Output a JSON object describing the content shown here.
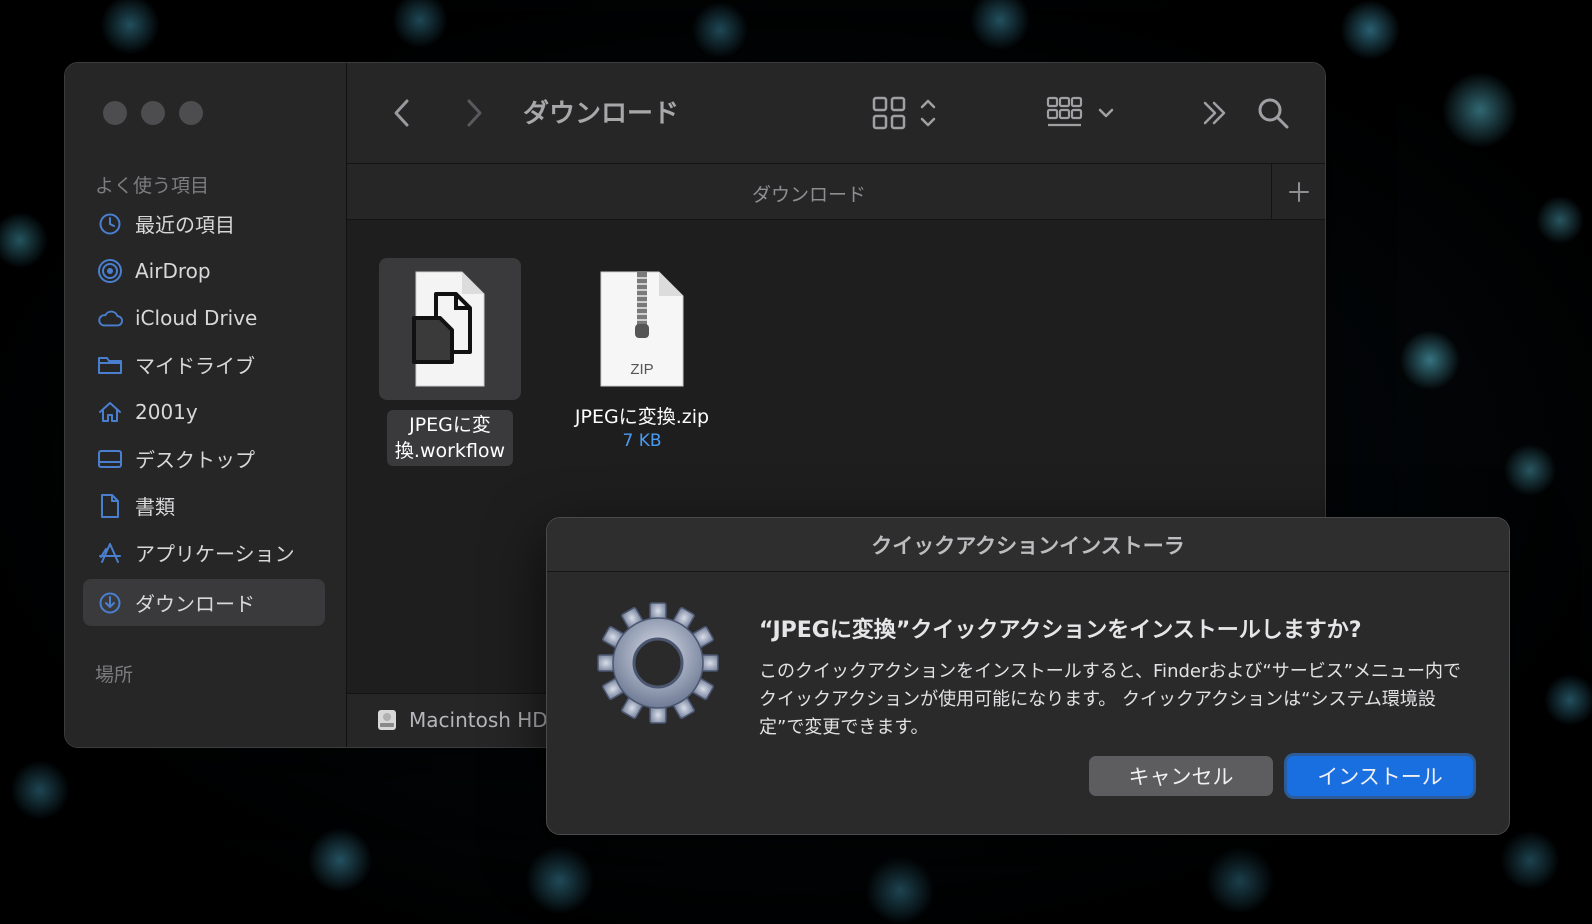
{
  "finder": {
    "toolbar": {
      "title": "ダウンロード"
    },
    "pathbar": {
      "label": "ダウンロード"
    },
    "sidebar": {
      "favorites_header": "よく使う項目",
      "locations_header": "場所",
      "items": [
        {
          "label": "最近の項目",
          "icon": "clock-icon"
        },
        {
          "label": "AirDrop",
          "icon": "airdrop-icon"
        },
        {
          "label": "iCloud Drive",
          "icon": "cloud-icon"
        },
        {
          "label": "マイドライブ",
          "icon": "folder-icon"
        },
        {
          "label": "2001y",
          "icon": "home-icon"
        },
        {
          "label": "デスクトップ",
          "icon": "desktop-icon"
        },
        {
          "label": "書類",
          "icon": "document-icon"
        },
        {
          "label": "アプリケーション",
          "icon": "applications-icon"
        },
        {
          "label": "ダウンロード",
          "icon": "download-icon",
          "active": true
        }
      ]
    },
    "files": [
      {
        "name": "JPEGに変換.workflow",
        "name_line1": "JPEGに変",
        "name_line2": "換.workflow",
        "icon": "workflow-file-icon",
        "selected": true
      },
      {
        "name": "JPEGに変換.zip",
        "size": "7 KB",
        "icon": "zip-file-icon",
        "badge": "ZIP"
      }
    ],
    "statusbar": {
      "disk": "Macintosh HD"
    }
  },
  "dialog": {
    "title": "クイックアクションインストーラ",
    "heading": "“JPEGに変換”クイックアクションをインストールしますか?",
    "body": "このクイックアクションをインストールすると、Finderおよび“サービス”メニュー内でクイックアクションが使用可能になります。 クイックアクションは“システム環境設定”で変更できます。",
    "cancel_label": "キャンセル",
    "install_label": "インストール"
  },
  "colors": {
    "accent": "#1a6fe0",
    "sidebar_icon": "#4a7fcf",
    "file_size": "#4a9cf2"
  }
}
